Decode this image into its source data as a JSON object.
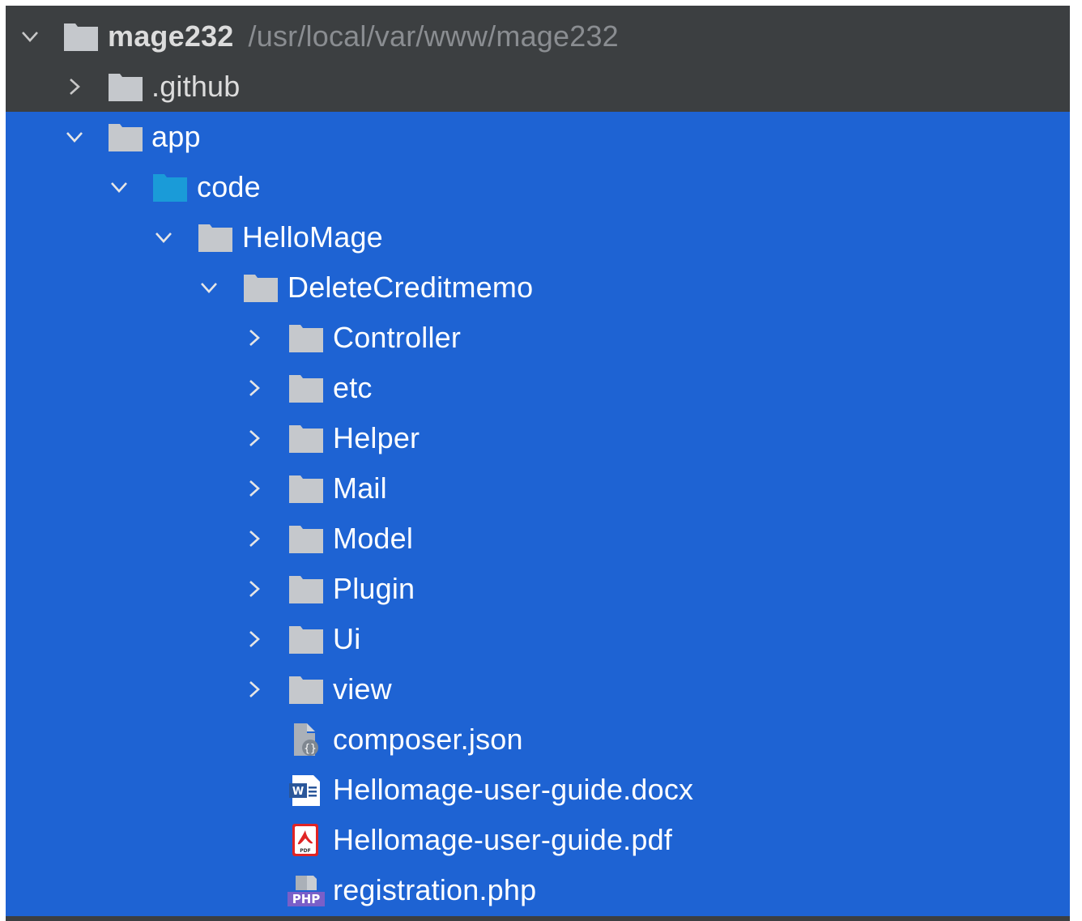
{
  "project": {
    "root_name": "mage232",
    "root_path": "/usr/local/var/www/mage232"
  },
  "tree": {
    "github": ".github",
    "app": "app",
    "code": "code",
    "hellomage": "HelloMage",
    "module": "DeleteCreditmemo",
    "folders": [
      "Controller",
      "etc",
      "Helper",
      "Mail",
      "Model",
      "Plugin",
      "Ui",
      "view"
    ],
    "files": [
      {
        "name": "composer.json",
        "icon": "json-file-icon"
      },
      {
        "name": "Hellomage-user-guide.docx",
        "icon": "word-file-icon"
      },
      {
        "name": "Hellomage-user-guide.pdf",
        "icon": "pdf-file-icon"
      },
      {
        "name": "registration.php",
        "icon": "php-file-icon"
      }
    ]
  },
  "icon_labels": {
    "word": "W",
    "pdf": "PDF",
    "php": "PHP"
  },
  "colors": {
    "panel_bg": "#3c3f41",
    "selection_bg": "#1e63d3",
    "folder_gray": "#c5c8cc",
    "folder_source_blue": "#1a9bd8",
    "path_text": "#8a8d91"
  }
}
